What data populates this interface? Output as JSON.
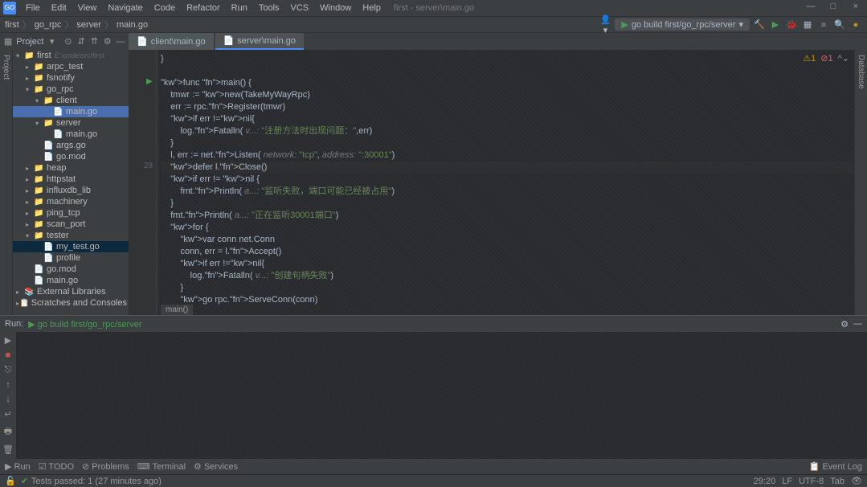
{
  "menu": {
    "items": [
      "File",
      "Edit",
      "View",
      "Navigate",
      "Code",
      "Refactor",
      "Run",
      "Tools",
      "VCS",
      "Window",
      "Help"
    ],
    "context": "first - server\\main.go"
  },
  "winbtns": {
    "min": "—",
    "max": "□",
    "close": "×"
  },
  "nav": {
    "crumbs": [
      "first",
      "go_rpc",
      "server",
      "main.go"
    ],
    "runconfig": "go build first/go_rpc/server"
  },
  "toolbar": {
    "project_label": "Project"
  },
  "tabs": [
    {
      "label": "client\\main.go",
      "active": false
    },
    {
      "label": "server\\main.go",
      "active": true
    }
  ],
  "tree": [
    {
      "d": 0,
      "a": "v",
      "i": "📁",
      "n": "first",
      "extra": "E:\\code\\src\\first",
      "sel": false
    },
    {
      "d": 1,
      "a": ">",
      "i": "📁",
      "n": "arpc_test"
    },
    {
      "d": 1,
      "a": ">",
      "i": "📁",
      "n": "fsnotify"
    },
    {
      "d": 1,
      "a": "v",
      "i": "📁",
      "n": "go_rpc"
    },
    {
      "d": 2,
      "a": "v",
      "i": "📁",
      "n": "client"
    },
    {
      "d": 3,
      "a": "",
      "i": "📄",
      "n": "main.go",
      "hl": true
    },
    {
      "d": 2,
      "a": "v",
      "i": "📁",
      "n": "server"
    },
    {
      "d": 3,
      "a": "",
      "i": "📄",
      "n": "main.go"
    },
    {
      "d": 2,
      "a": "",
      "i": "📄",
      "n": "args.go"
    },
    {
      "d": 2,
      "a": "",
      "i": "📄",
      "n": "go.mod"
    },
    {
      "d": 1,
      "a": ">",
      "i": "📁",
      "n": "heap"
    },
    {
      "d": 1,
      "a": ">",
      "i": "📁",
      "n": "httpstat"
    },
    {
      "d": 1,
      "a": ">",
      "i": "📁",
      "n": "influxdb_lib"
    },
    {
      "d": 1,
      "a": ">",
      "i": "📁",
      "n": "machinery"
    },
    {
      "d": 1,
      "a": ">",
      "i": "📁",
      "n": "ping_tcp"
    },
    {
      "d": 1,
      "a": ">",
      "i": "📁",
      "n": "scan_port"
    },
    {
      "d": 1,
      "a": "v",
      "i": "📁",
      "n": "tester"
    },
    {
      "d": 2,
      "a": "",
      "i": "📄",
      "n": "my_test.go",
      "sel": true
    },
    {
      "d": 2,
      "a": "",
      "i": "📄",
      "n": "profile"
    },
    {
      "d": 1,
      "a": "",
      "i": "📄",
      "n": "go.mod"
    },
    {
      "d": 1,
      "a": "",
      "i": "📄",
      "n": "main.go"
    },
    {
      "d": 0,
      "a": ">",
      "i": "📚",
      "n": "External Libraries"
    },
    {
      "d": 0,
      "a": ">",
      "i": "📋",
      "n": "Scratches and Consoles"
    }
  ],
  "code": {
    "lines": [
      "}",
      "",
      "func main() {",
      "    tmwr := new(TakeMyWayRpc)",
      "    err := rpc.Register(tmwr)",
      "    if err !=nil{",
      "        log.Fatalln( v...: \"注册方法时出现问题：\",err)",
      "    }",
      "    l, err := net.Listen( network: \"tcp\", address: \":30001\")",
      "    defer l.Close()",
      "    if err != nil {",
      "        fmt.Println( a...: \"监听失败，端口可能已经被占用\")",
      "    }",
      "    fmt.Println( a...: \"正在监听30001端口\")",
      "    for {",
      "        var conn net.Conn",
      "        conn, err = l.Accept()",
      "        if err !=nil{",
      "            log.Fatalln( v...: \"创建句柄失败\")",
      "        }",
      "        go rpc.ServeConn(conn)"
    ],
    "linenum": "29",
    "breadcrumb": "main()"
  },
  "inspect": {
    "warn": "1",
    "err": "1"
  },
  "run": {
    "label": "Run:",
    "config": "go build first/go_rpc/server"
  },
  "status": {
    "items": [
      "Run",
      "TODO",
      "Problems",
      "Terminal",
      "Services"
    ],
    "event": "Event Log"
  },
  "footer": {
    "tests": "Tests passed: 1 (27 minutes ago)",
    "pos": "29:20",
    "le": "LF",
    "enc": "UTF-8",
    "indent": "Tab"
  }
}
